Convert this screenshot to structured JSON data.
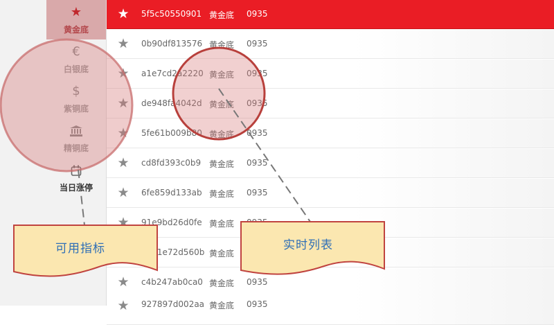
{
  "sidebar": {
    "items": [
      {
        "label": "黄金底",
        "icon": "star-icon",
        "glyph": "★"
      },
      {
        "label": "白银底",
        "icon": "euro-icon",
        "glyph": "€"
      },
      {
        "label": "紫铜底",
        "icon": "dollar-icon",
        "glyph": "$"
      },
      {
        "label": "精铜底",
        "icon": "bank-icon",
        "glyph": "🏛"
      },
      {
        "label": "当日涨停",
        "icon": "calendar-icon",
        "glyph": "▢"
      }
    ]
  },
  "list": {
    "rows": [
      {
        "code": "5f5c50550901",
        "category": "黄金底",
        "number": "0935"
      },
      {
        "code": "0b90df813576",
        "category": "黄金底",
        "number": "0935"
      },
      {
        "code": "a1e7cd2a2220",
        "category": "黄金底",
        "number": "0935"
      },
      {
        "code": "de948fa4042d",
        "category": "黄金底",
        "number": "0935"
      },
      {
        "code": "5fe61b009b80",
        "category": "黄金底",
        "number": "0935"
      },
      {
        "code": "cd8fd393c0b9",
        "category": "黄金底",
        "number": "0935"
      },
      {
        "code": "6fe859d133ab",
        "category": "黄金底",
        "number": "0935"
      },
      {
        "code": "91e9bd26d0fe",
        "category": "黄金底",
        "number": "0935"
      },
      {
        "code": "8601e72d560b",
        "category": "黄金底",
        "number": "0935"
      },
      {
        "code": "c4b247ab0ca0",
        "category": "黄金底",
        "number": "0935"
      },
      {
        "code": "927897d002aa",
        "category": "黄金底",
        "number": "0935"
      }
    ]
  },
  "annotations": {
    "indicators_label": "可用指标",
    "realtime_label": "实时列表"
  },
  "colors": {
    "accent": "#ea1d25",
    "callout_fill": "#fbe7b0",
    "callout_border": "#c0433f",
    "callout_text": "#2f6fb6"
  }
}
